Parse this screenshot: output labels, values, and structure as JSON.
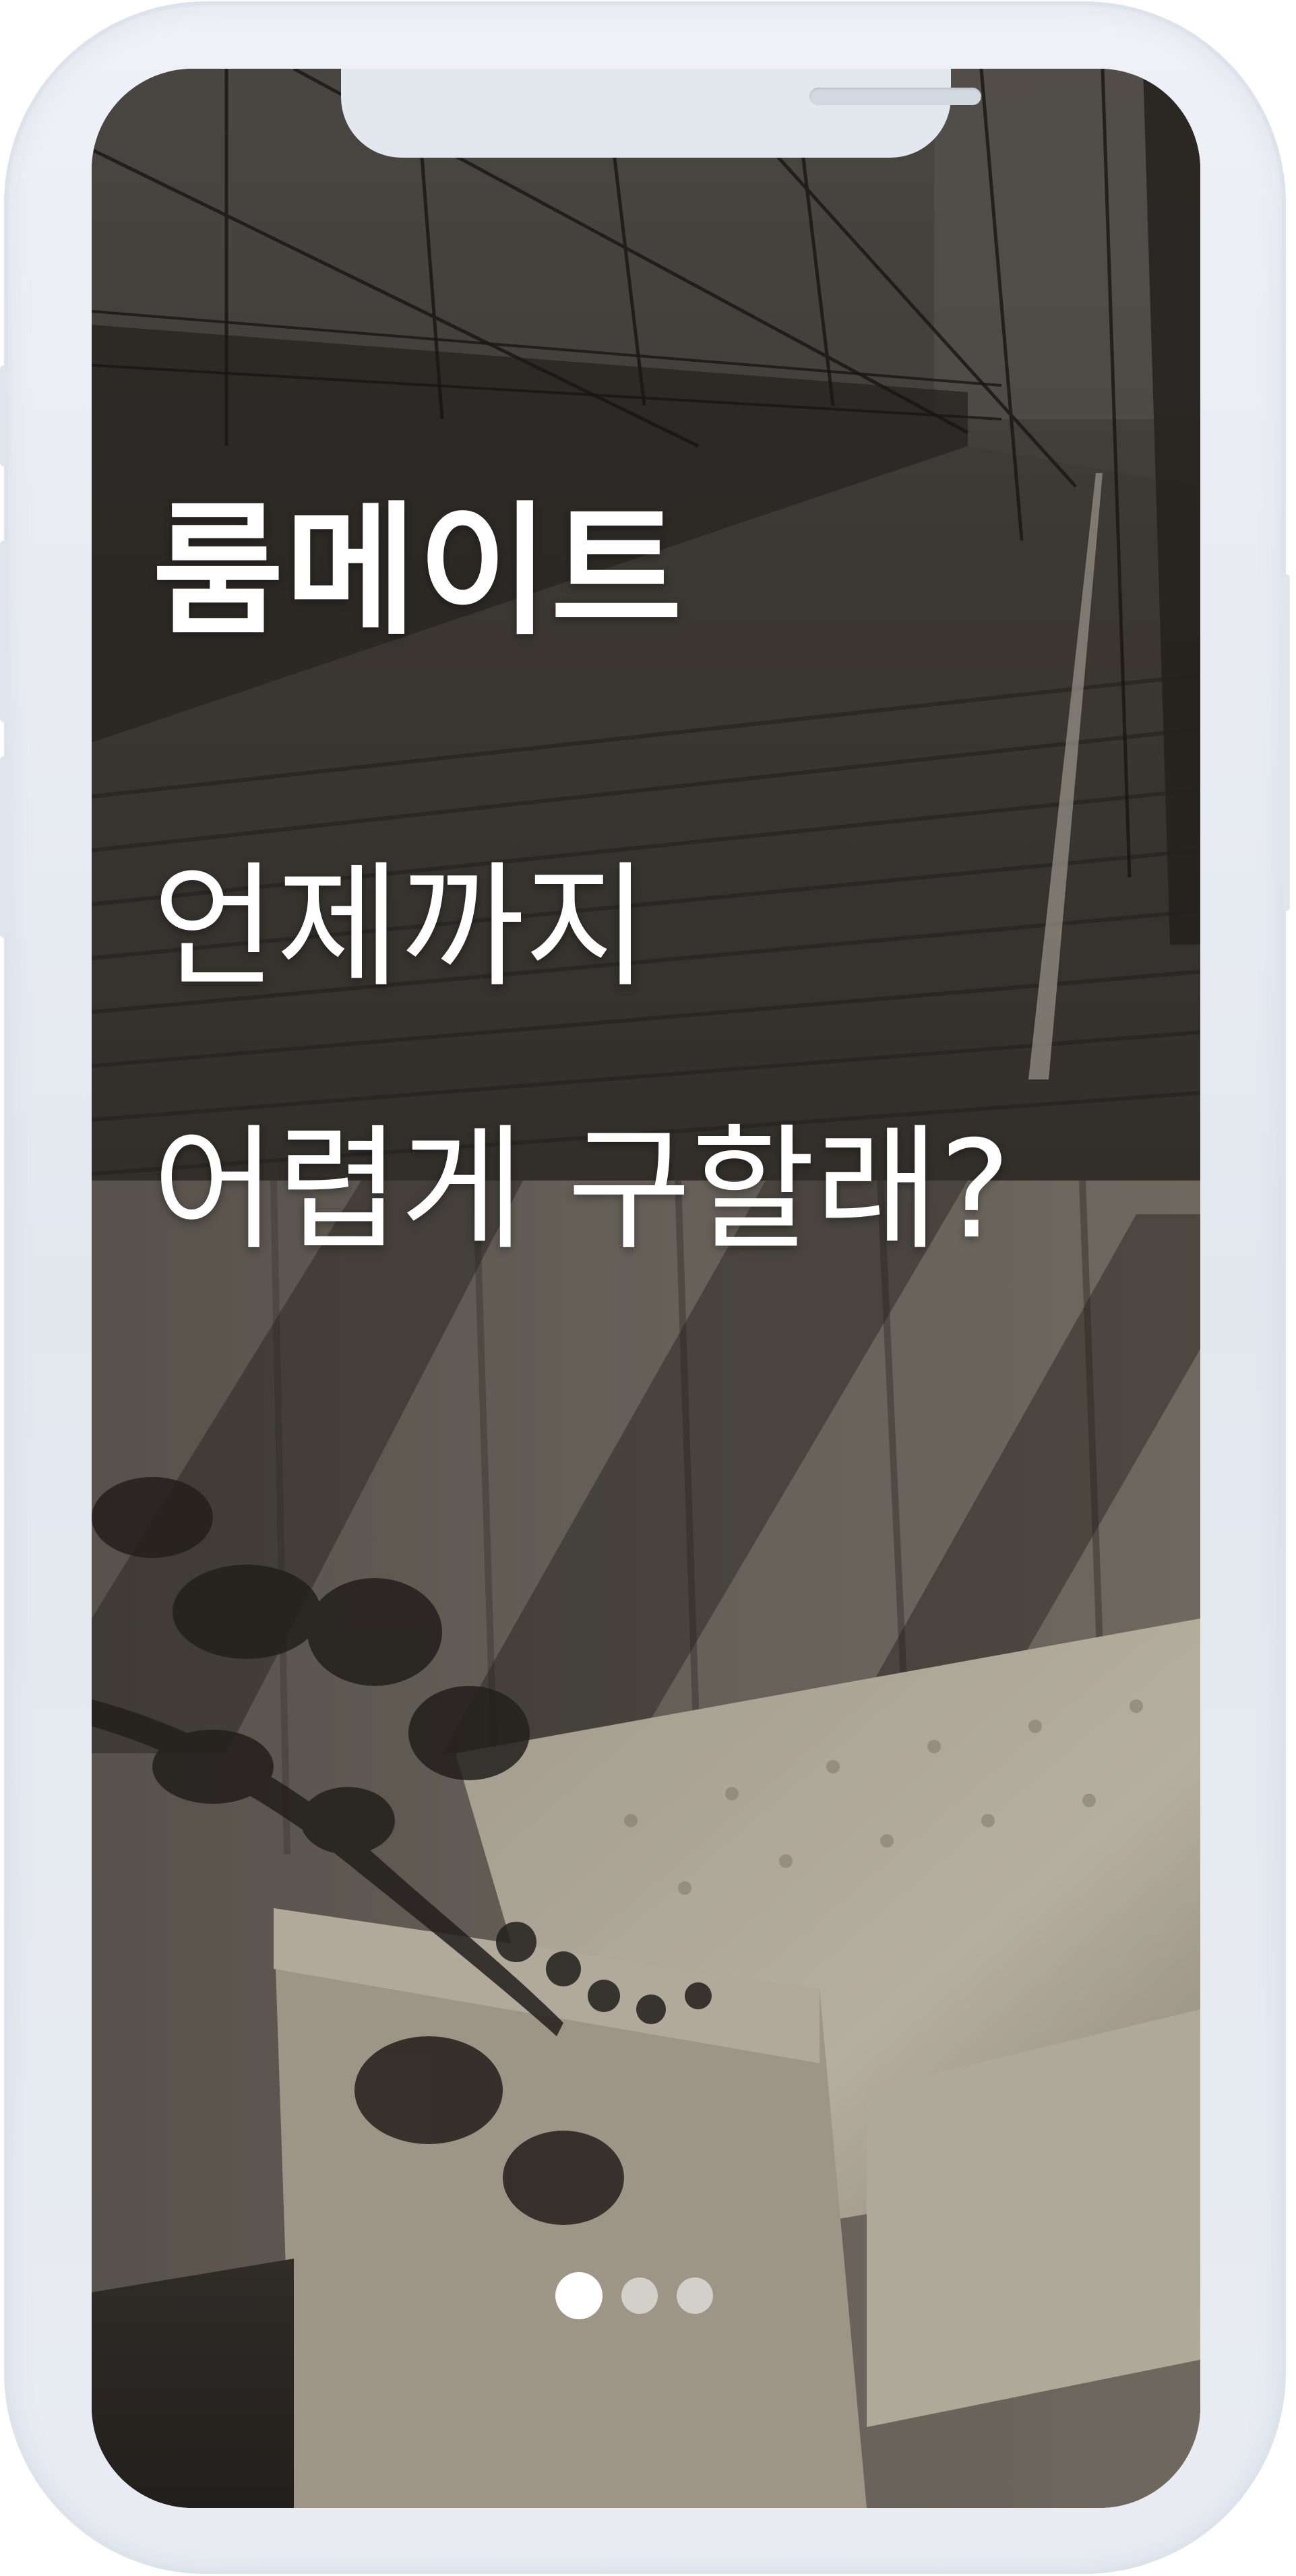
{
  "onboarding": {
    "brand_title": "룸메이트",
    "headline_line1": "언제까지",
    "headline_line2": "어렵게 구할래?"
  },
  "pagination": {
    "total_pages": 3,
    "active_page": 1
  },
  "background": {
    "description_icon": "bridge-and-sofa-photo"
  },
  "colors": {
    "text": "#ffffff",
    "device_frame": "#e3e8ef",
    "dot_inactive": "#c9c9c9",
    "dot_active": "#ffffff"
  }
}
